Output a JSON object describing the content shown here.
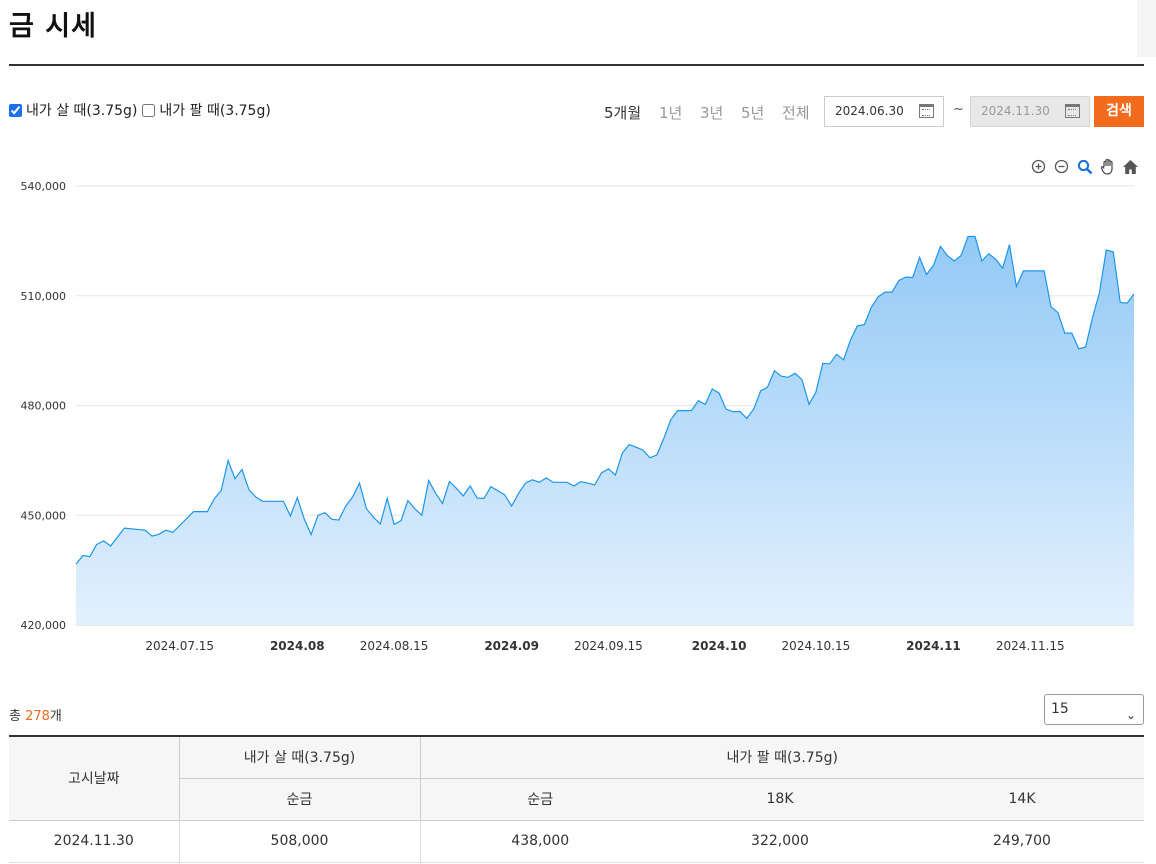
{
  "page": {
    "title": "금 시세"
  },
  "filters": {
    "buy_checkbox_label": "내가 살 때(3.75g)",
    "buy_checked": true,
    "sell_checkbox_label": "내가 팔 때(3.75g)",
    "sell_checked": false,
    "periods": [
      "5개월",
      "1년",
      "3년",
      "5년",
      "전체"
    ],
    "active_period": "5개월",
    "start_date": "2024.06.30",
    "end_date": "2024.11.30",
    "range_separator": "~",
    "search_label": "검색"
  },
  "toolbar": {
    "icons": [
      "zoom-in-icon",
      "zoom-out-icon",
      "magnifier-icon",
      "pan-hand-icon",
      "home-icon"
    ]
  },
  "chart_data": {
    "type": "area",
    "series": [
      {
        "values_note": "buy price 3.75g",
        "color": "#1e96e8"
      }
    ],
    "ylim": [
      420000,
      540000
    ],
    "yticks": [
      "540,000",
      "510,000",
      "480,000",
      "450,000",
      "420,000"
    ],
    "xticks": [
      {
        "label": "2024.07.15",
        "bold": false,
        "date": "2024-07-15"
      },
      {
        "label": "2024.08",
        "bold": true,
        "date": "2024-08-01"
      },
      {
        "label": "2024.08.15",
        "bold": false,
        "date": "2024-08-15"
      },
      {
        "label": "2024.09",
        "bold": true,
        "date": "2024-09-01"
      },
      {
        "label": "2024.09.15",
        "bold": false,
        "date": "2024-09-15"
      },
      {
        "label": "2024.10",
        "bold": true,
        "date": "2024-10-01"
      },
      {
        "label": "2024.10.15",
        "bold": false,
        "date": "2024-10-15"
      },
      {
        "label": "2024.11",
        "bold": true,
        "date": "2024-11-01"
      },
      {
        "label": "2024.11.15",
        "bold": false,
        "date": "2024-11-15"
      }
    ],
    "grid": true,
    "points": [
      [
        "2024-06-30",
        436600
      ],
      [
        "2024-07-01",
        439000
      ],
      [
        "2024-07-02",
        438700
      ],
      [
        "2024-07-03",
        442000
      ],
      [
        "2024-07-04",
        443000
      ],
      [
        "2024-07-05",
        441600
      ],
      [
        "2024-07-07",
        446500
      ],
      [
        "2024-07-08",
        446300
      ],
      [
        "2024-07-10",
        445900
      ],
      [
        "2024-07-11",
        444300
      ],
      [
        "2024-07-12",
        444800
      ],
      [
        "2024-07-13",
        445900
      ],
      [
        "2024-07-14",
        445300
      ],
      [
        "2024-07-15",
        447200
      ],
      [
        "2024-07-17",
        451000
      ],
      [
        "2024-07-18",
        451000
      ],
      [
        "2024-07-19",
        451000
      ],
      [
        "2024-07-20",
        454500
      ],
      [
        "2024-07-21",
        456800
      ],
      [
        "2024-07-22",
        465000
      ],
      [
        "2024-07-23",
        460000
      ],
      [
        "2024-07-24",
        462500
      ],
      [
        "2024-07-25",
        457000
      ],
      [
        "2024-07-26",
        455000
      ],
      [
        "2024-07-27",
        453800
      ],
      [
        "2024-07-29",
        453800
      ],
      [
        "2024-07-30",
        453800
      ],
      [
        "2024-07-31",
        449800
      ],
      [
        "2024-08-01",
        454800
      ],
      [
        "2024-08-02",
        449000
      ],
      [
        "2024-08-03",
        444700
      ],
      [
        "2024-08-04",
        450000
      ],
      [
        "2024-08-05",
        450700
      ],
      [
        "2024-08-06",
        448900
      ],
      [
        "2024-08-07",
        448700
      ],
      [
        "2024-08-08",
        452500
      ],
      [
        "2024-08-09",
        455000
      ],
      [
        "2024-08-10",
        458800
      ],
      [
        "2024-08-11",
        451800
      ],
      [
        "2024-08-12",
        449500
      ],
      [
        "2024-08-13",
        447600
      ],
      [
        "2024-08-14",
        454600
      ],
      [
        "2024-08-15",
        447500
      ],
      [
        "2024-08-16",
        448500
      ],
      [
        "2024-08-17",
        454000
      ],
      [
        "2024-08-18",
        451800
      ],
      [
        "2024-08-19",
        450000
      ],
      [
        "2024-08-20",
        459500
      ],
      [
        "2024-08-21",
        456000
      ],
      [
        "2024-08-22",
        453200
      ],
      [
        "2024-08-23",
        459200
      ],
      [
        "2024-08-24",
        457400
      ],
      [
        "2024-08-25",
        455300
      ],
      [
        "2024-08-26",
        458000
      ],
      [
        "2024-08-27",
        454700
      ],
      [
        "2024-08-28",
        454600
      ],
      [
        "2024-08-29",
        457800
      ],
      [
        "2024-08-31",
        455600
      ],
      [
        "2024-09-01",
        452500
      ],
      [
        "2024-09-02",
        456000
      ],
      [
        "2024-09-03",
        458800
      ],
      [
        "2024-09-04",
        459700
      ],
      [
        "2024-09-05",
        459000
      ],
      [
        "2024-09-06",
        460200
      ],
      [
        "2024-09-07",
        459000
      ],
      [
        "2024-09-09",
        459000
      ],
      [
        "2024-09-10",
        458000
      ],
      [
        "2024-09-11",
        459200
      ],
      [
        "2024-09-12",
        458800
      ],
      [
        "2024-09-13",
        458300
      ],
      [
        "2024-09-14",
        461600
      ],
      [
        "2024-09-15",
        462700
      ],
      [
        "2024-09-16",
        461000
      ],
      [
        "2024-09-17",
        467000
      ],
      [
        "2024-09-18",
        469300
      ],
      [
        "2024-09-19",
        468600
      ],
      [
        "2024-09-20",
        467800
      ],
      [
        "2024-09-21",
        465700
      ],
      [
        "2024-09-22",
        466500
      ],
      [
        "2024-09-23",
        471000
      ],
      [
        "2024-09-24",
        476100
      ],
      [
        "2024-09-25",
        478600
      ],
      [
        "2024-09-26",
        478600
      ],
      [
        "2024-09-27",
        478600
      ],
      [
        "2024-09-28",
        481300
      ],
      [
        "2024-09-29",
        480300
      ],
      [
        "2024-09-30",
        484500
      ],
      [
        "2024-10-01",
        483400
      ],
      [
        "2024-10-02",
        479000
      ],
      [
        "2024-10-03",
        478300
      ],
      [
        "2024-10-04",
        478400
      ],
      [
        "2024-10-05",
        476500
      ],
      [
        "2024-10-06",
        479000
      ],
      [
        "2024-10-07",
        484000
      ],
      [
        "2024-10-08",
        485000
      ],
      [
        "2024-10-09",
        489500
      ],
      [
        "2024-10-10",
        488000
      ],
      [
        "2024-10-11",
        487700
      ],
      [
        "2024-10-12",
        488800
      ],
      [
        "2024-10-13",
        487000
      ],
      [
        "2024-10-14",
        480300
      ],
      [
        "2024-10-15",
        483700
      ],
      [
        "2024-10-16",
        491500
      ],
      [
        "2024-10-17",
        491400
      ],
      [
        "2024-10-18",
        494000
      ],
      [
        "2024-10-19",
        492500
      ],
      [
        "2024-10-20",
        497900
      ],
      [
        "2024-10-21",
        501800
      ],
      [
        "2024-10-22",
        502100
      ],
      [
        "2024-10-23",
        506800
      ],
      [
        "2024-10-24",
        509700
      ],
      [
        "2024-10-25",
        511000
      ],
      [
        "2024-10-26",
        511000
      ],
      [
        "2024-10-27",
        514200
      ],
      [
        "2024-10-28",
        515100
      ],
      [
        "2024-10-29",
        515000
      ],
      [
        "2024-10-30",
        520500
      ],
      [
        "2024-10-31",
        515800
      ],
      [
        "2024-11-01",
        518300
      ],
      [
        "2024-11-02",
        523500
      ],
      [
        "2024-11-03",
        521000
      ],
      [
        "2024-11-04",
        519500
      ],
      [
        "2024-11-05",
        521000
      ],
      [
        "2024-11-06",
        526200
      ],
      [
        "2024-11-07",
        526200
      ],
      [
        "2024-11-08",
        519500
      ],
      [
        "2024-11-09",
        521500
      ],
      [
        "2024-11-10",
        520000
      ],
      [
        "2024-11-11",
        517500
      ],
      [
        "2024-11-12",
        524000
      ],
      [
        "2024-11-13",
        512500
      ],
      [
        "2024-11-14",
        516800
      ],
      [
        "2024-11-15",
        516800
      ],
      [
        "2024-11-16",
        516800
      ],
      [
        "2024-11-17",
        516800
      ],
      [
        "2024-11-18",
        507000
      ],
      [
        "2024-11-19",
        505400
      ],
      [
        "2024-11-20",
        499800
      ],
      [
        "2024-11-21",
        499800
      ],
      [
        "2024-11-22",
        495500
      ],
      [
        "2024-11-23",
        496000
      ],
      [
        "2024-11-24",
        504000
      ],
      [
        "2024-11-25",
        510800
      ],
      [
        "2024-11-26",
        522500
      ],
      [
        "2024-11-27",
        522000
      ],
      [
        "2024-11-28",
        508200
      ],
      [
        "2024-11-29",
        508000
      ],
      [
        "2024-11-30",
        510500
      ]
    ]
  },
  "summary": {
    "prefix": "총 ",
    "count": "278",
    "suffix": "개"
  },
  "page_size": {
    "selected": "15",
    "chevron": "⌄"
  },
  "table": {
    "date_header": "고시날짜",
    "buy_header": "내가 살 때(3.75g)",
    "sell_header": "내가 팔 때(3.75g)",
    "buy_sub": "순금",
    "sell_subs": [
      "순금",
      "18K",
      "14K"
    ],
    "rows": [
      {
        "date": "2024.11.30",
        "buy_pure": "508,000",
        "sell_pure": "438,000",
        "sell_18k": "322,000",
        "sell_14k": "249,700"
      }
    ]
  },
  "colors": {
    "accent": "#f26b1d",
    "line": "#1e96e8",
    "area_top": "#93c9f6",
    "area_bottom": "#e3f1fd"
  }
}
